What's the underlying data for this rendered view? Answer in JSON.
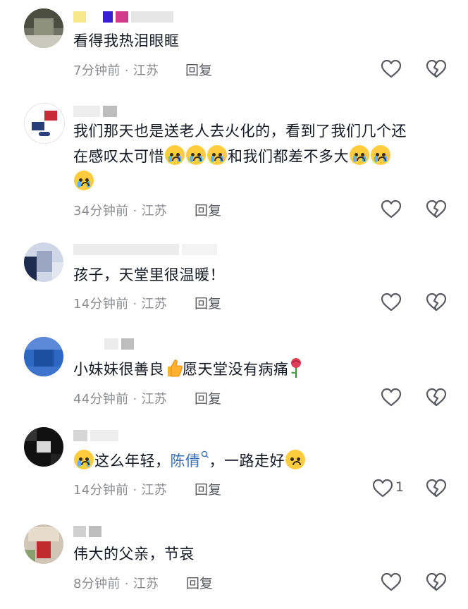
{
  "comments": [
    {
      "text": "看得我热泪眼眶",
      "time": "7分钟前",
      "dot": "·",
      "location": "江苏",
      "reply_label": "回复",
      "likes": ""
    },
    {
      "text_line1": "我们那天也是送老人去火化的，看到了我们几个还",
      "text_line2_a": "在感叹太可惜",
      "text_line2_b": "和我们都差不多大",
      "time": "34分钟前",
      "dot": "·",
      "location": "江苏",
      "reply_label": "回复",
      "likes": ""
    },
    {
      "text": "孩子，天堂里很温暖！",
      "time": "14分钟前",
      "dot": "·",
      "location": "江苏",
      "reply_label": "回复",
      "likes": ""
    },
    {
      "text_a": "小妹妹很善良",
      "text_b": "愿天堂没有病痛",
      "time": "44分钟前",
      "dot": "·",
      "location": "江苏",
      "reply_label": "回复",
      "likes": ""
    },
    {
      "text_a": "这么年轻，",
      "mention": "陈倩",
      "text_b": "，一路走好",
      "time": "14分钟前",
      "dot": "·",
      "location": "江苏",
      "reply_label": "回复",
      "likes": "1"
    },
    {
      "text": "伟大的父亲，节哀",
      "time": "8分钟前",
      "dot": "·",
      "location": "江苏",
      "reply_label": "回复",
      "likes": ""
    }
  ],
  "icons": {
    "like": "heart-outline-icon",
    "dislike": "broken-heart-icon",
    "emoji_cry": "loudly-crying-face-icon",
    "emoji_pleading": "pleading-face-icon",
    "emoji_thumb": "thumbs-up-icon",
    "emoji_rose": "rose-icon",
    "mention": "search-icon"
  },
  "colors": {
    "text": "#161823",
    "meta": "#8a8b91",
    "mention": "#3b6fb6"
  }
}
